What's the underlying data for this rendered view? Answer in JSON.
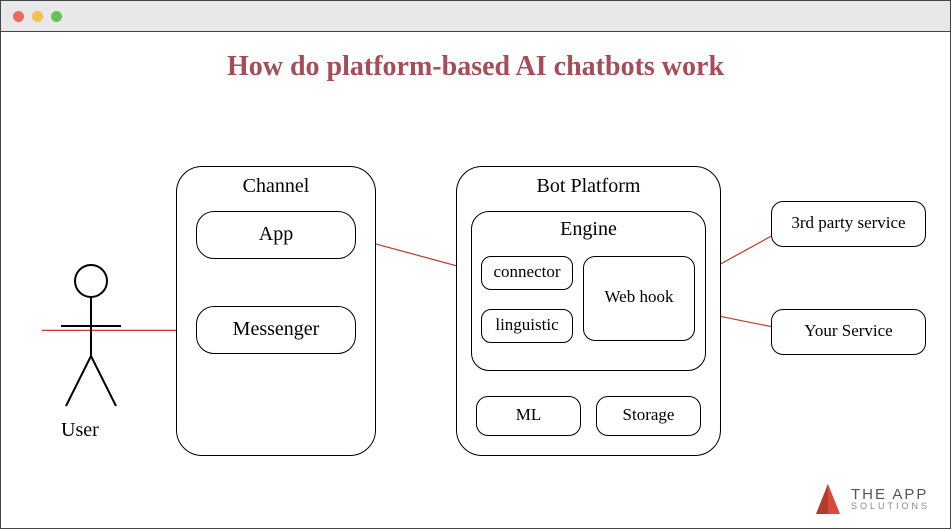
{
  "title": "How do platform-based AI chatbots work",
  "actors": {
    "user": "User"
  },
  "channel": {
    "label": "Channel",
    "app": "App",
    "messenger": "Messenger"
  },
  "platform": {
    "label": "Bot Platform",
    "engine": {
      "label": "Engine",
      "connector": "connector",
      "linguistic": "linguistic",
      "webhook": "Web hook"
    },
    "ml": "ML",
    "storage": "Storage"
  },
  "external": {
    "third_party": "3rd party service",
    "your_service": "Your Service"
  },
  "brand": {
    "line1": "THE APP",
    "line2": "SOLUTIONS"
  },
  "colors": {
    "title": "#a64d57",
    "connector": "#c0392b",
    "logo": "#d9483b"
  }
}
